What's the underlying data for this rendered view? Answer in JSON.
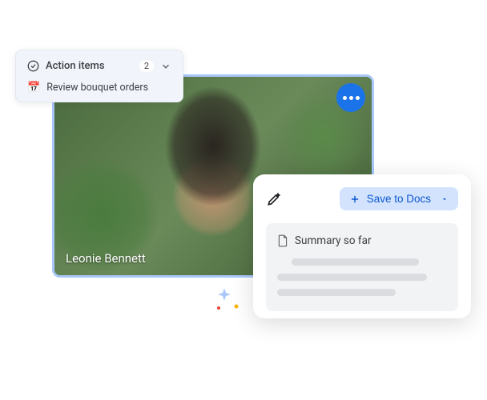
{
  "video_tile": {
    "participant_name": "Leonie Bennett"
  },
  "action_panel": {
    "title": "Action items",
    "count": "2",
    "items": [
      {
        "icon": "📅",
        "text": "Review bouquet orders"
      }
    ]
  },
  "summary_panel": {
    "save_button_label": "Save to Docs",
    "summary_title": "Summary so far"
  },
  "colors": {
    "primary": "#1a73e8",
    "save_bg": "#d3e3fd",
    "save_fg": "#0b57d0"
  }
}
